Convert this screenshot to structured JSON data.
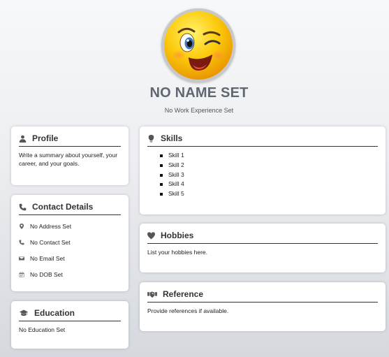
{
  "header": {
    "name": "NO NAME SET",
    "job": "No Work Experience Set"
  },
  "profile": {
    "title": "Profile",
    "summary": "Write a summary about yourself, your career, and your goals."
  },
  "contact": {
    "title": "Contact Details",
    "address": "No Address Set",
    "phone": "No Contact Set",
    "email": "No Email Set",
    "dob": "No DOB Set"
  },
  "education": {
    "title": "Education",
    "text": "No Education Set"
  },
  "skills": {
    "title": "Skills",
    "items": [
      "Skill 1",
      "Skill 2",
      "Skill 3",
      "Skill 4",
      "Skill 5"
    ]
  },
  "hobbies": {
    "title": "Hobbies",
    "text": "List your hobbies here."
  },
  "reference": {
    "title": "Reference",
    "text": "Provide references if available."
  },
  "icons": {
    "avatar": "winking-smiley-icon",
    "profile": "user-icon",
    "contact": "phone-icon",
    "address": "map-marker-icon",
    "phone": "phone-icon",
    "email": "envelope-icon",
    "dob": "calendar-icon",
    "education": "graduation-cap-icon",
    "skills": "lightbulb-icon",
    "hobbies": "heart-icon",
    "reference": "handshake-icon"
  }
}
